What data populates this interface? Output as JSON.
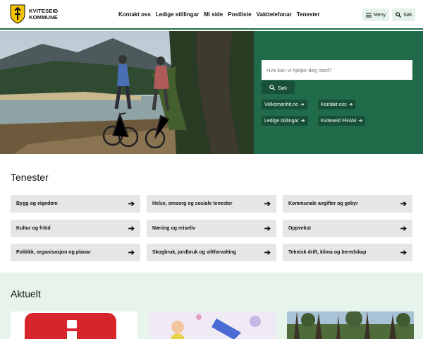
{
  "header": {
    "logo_line1": "KVITESEID",
    "logo_line2": "KOMMUNE",
    "nav": [
      "Kontakt oss",
      "Ledige stillingar",
      "Mi side",
      "Postliste",
      "Vakttelefonar",
      "Tenester"
    ],
    "menu_label": "Meny",
    "search_label": "Søk"
  },
  "hero": {
    "search_placeholder": "Hva kan vi hjelpe deg med?",
    "search_button": "Søk",
    "quick_links": [
      "Velkomenhit.no",
      "Kontakt oss",
      "Ledige stillingar",
      "Kviteseid FRAM"
    ]
  },
  "services": {
    "title": "Tenester",
    "items": [
      "Bygg og eigedom",
      "Helse, omsorg og sosiale tenester",
      "Kommunale avgifter og gebyr",
      "Kultur og fritid",
      "Næring og reiseliv",
      "Oppvekst",
      "Politikk, organisasjon og planar",
      "Skogbruk, jordbruk og viltforvalting",
      "Teknisk drift, klima og beredskap"
    ]
  },
  "news": {
    "title": "Aktuelt"
  },
  "colors": {
    "brand_green": "#1f6b4a",
    "dark_green": "#174f37",
    "tile_gray": "#e6e6e6",
    "mint": "#e6f4ec"
  }
}
